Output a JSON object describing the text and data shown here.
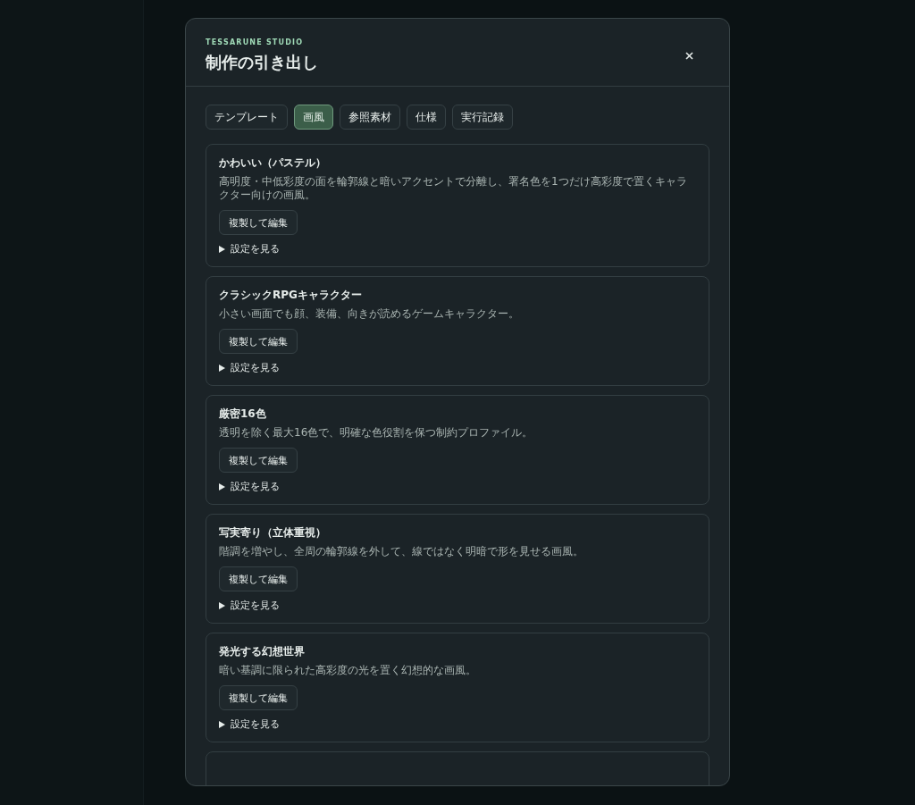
{
  "dialog": {
    "eyebrow": "TESSARUNE STUDIO",
    "title": "制作の引き出し"
  },
  "tabs": [
    {
      "label": "テンプレート",
      "selected": false
    },
    {
      "label": "画風",
      "selected": true
    },
    {
      "label": "参照素材",
      "selected": false
    },
    {
      "label": "仕様",
      "selected": false
    },
    {
      "label": "実行記録",
      "selected": false
    }
  ],
  "styles": [
    {
      "name": "かわいい（パステル）",
      "description": "高明度・中低彩度の面を輪郭線と暗いアクセントで分離し、署名色を1つだけ高彩度で置くキャラクター向けの画風。",
      "action": "複製して編集",
      "details": "設定を見る",
      "expanded": false
    },
    {
      "name": "クラシックRPGキャラクター",
      "description": "小さい画面でも顔、装備、向きが読めるゲームキャラクター。",
      "action": "複製して編集",
      "details": "設定を見る",
      "expanded": false
    },
    {
      "name": "厳密16色",
      "description": "透明を除く最大16色で、明確な色役割を保つ制約プロファイル。",
      "action": "複製して編集",
      "details": "設定を見る",
      "expanded": false
    },
    {
      "name": "写実寄り（立体重視）",
      "description": "階調を増やし、全周の輪郭線を外して、線ではなく明暗で形を見せる画風。",
      "action": "複製して編集",
      "details": "設定を見る",
      "expanded": false
    },
    {
      "name": "発光する幻想世界",
      "description": "暗い基調に限られた高彩度の光を置く幻想的な画風。",
      "action": "複製して編集",
      "details": "設定を見る",
      "expanded": false
    }
  ]
}
